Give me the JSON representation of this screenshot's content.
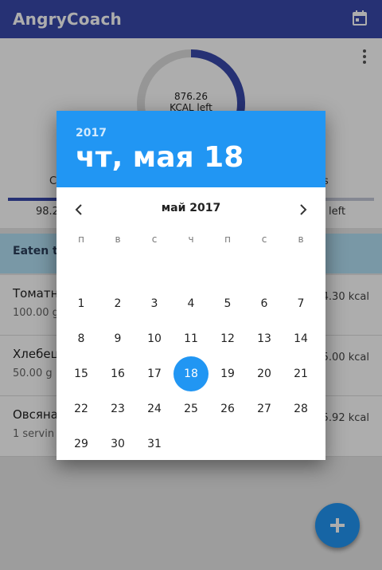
{
  "app": {
    "title": "AngryCoach",
    "calendar_icon": "calendar-icon",
    "more_icon": "more-vert-icon"
  },
  "summary": {
    "kcal_value": "876.26",
    "kcal_label": "KCAL left",
    "ring_progress": 0.3,
    "macros": [
      {
        "label_visible": "C",
        "value_visible": "98.2",
        "fill": 0.85
      },
      {
        "label_visible": "",
        "value_visible": "",
        "fill": 0.0
      },
      {
        "label_visible": "s",
        "value_visible": "left",
        "fill": 0.0
      }
    ]
  },
  "eaten": {
    "header_visible": "Eaten t",
    "items": [
      {
        "name_visible": "Томатн",
        "qty_visible": "100.00 g",
        "kcal_visible": "4.30 kcal"
      },
      {
        "name_visible": "Хлебец",
        "qty_visible": "50.00 g",
        "kcal_visible": "5.00 kcal"
      },
      {
        "name_visible": "Овсяна",
        "qty_visible": "1 servin",
        "kcal_visible": "5.92 kcal"
      }
    ]
  },
  "fab": {
    "icon": "plus-icon"
  },
  "colors": {
    "primary": "#3949ab",
    "accent": "#2196f3"
  },
  "datepicker": {
    "year": "2017",
    "selected_date_text": "чт, мая 18",
    "month_title": "май 2017",
    "prev_icon": "chevron-left-icon",
    "next_icon": "chevron-right-icon",
    "weekdays": [
      "п",
      "в",
      "с",
      "ч",
      "п",
      "с",
      "в"
    ],
    "weeks": [
      [
        "1",
        "2",
        "3",
        "4",
        "5",
        "6",
        "7"
      ],
      [
        "8",
        "9",
        "10",
        "11",
        "12",
        "13",
        "14"
      ],
      [
        "15",
        "16",
        "17",
        "18",
        "19",
        "20",
        "21"
      ],
      [
        "22",
        "23",
        "24",
        "25",
        "26",
        "27",
        "28"
      ],
      [
        "29",
        "30",
        "31"
      ]
    ],
    "selected_day": "18"
  }
}
